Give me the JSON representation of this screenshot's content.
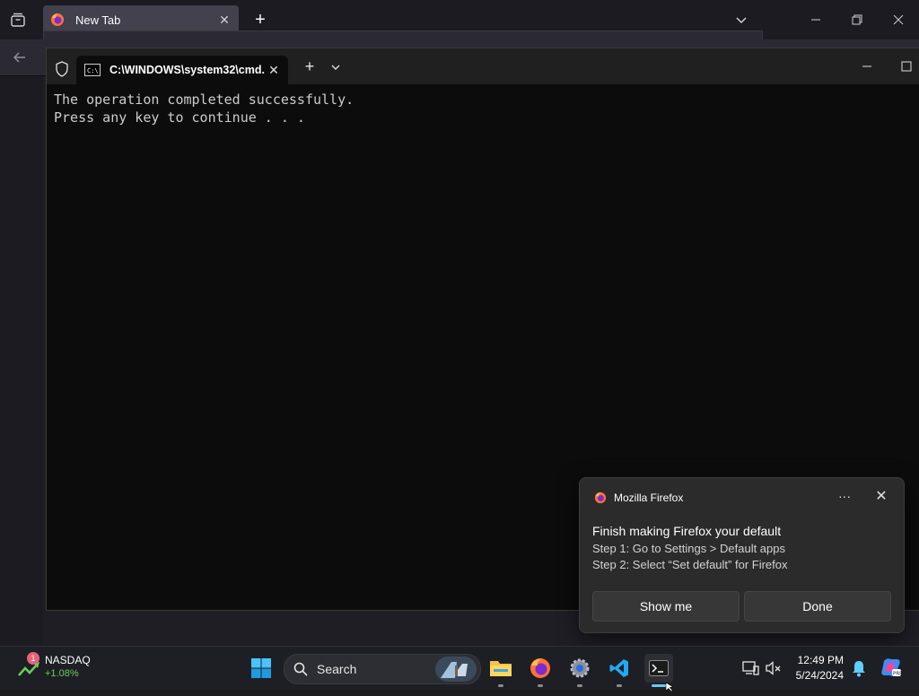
{
  "firefox": {
    "tab_title": "New Tab",
    "tab_close_glyph": "✕",
    "new_tab_glyph": "+"
  },
  "terminal": {
    "tab_title": "C:\\WINDOWS\\system32\\cmd.",
    "tab_close_glyph": "✕",
    "new_tab_glyph": "+",
    "output_lines": [
      "The operation completed successfully.",
      "Press any key to continue . . ."
    ],
    "background_color": "#0c0c0c",
    "text_color": "#cccccc"
  },
  "toast": {
    "app_name": "Mozilla Firefox",
    "more_glyph": "···",
    "close_glyph": "✕",
    "title": "Finish making Firefox your default",
    "line1": "Step 1: Go to Settings > Default apps",
    "line2": "Step 2: Select “Set default” for Firefox",
    "show_me_label": "Show me",
    "done_label": "Done"
  },
  "taskbar": {
    "widget": {
      "badge": "1",
      "name": "NASDAQ",
      "change": "+1.08%",
      "change_color": "#6ccb5f"
    },
    "search_label": "Search",
    "apps": [
      "start-icon",
      "file-explorer-icon",
      "firefox-icon",
      "settings-icon",
      "vscode-icon",
      "terminal-icon"
    ],
    "clock": {
      "time": "12:49 PM",
      "date": "5/24/2024"
    },
    "accent_color": "#60cdff"
  }
}
